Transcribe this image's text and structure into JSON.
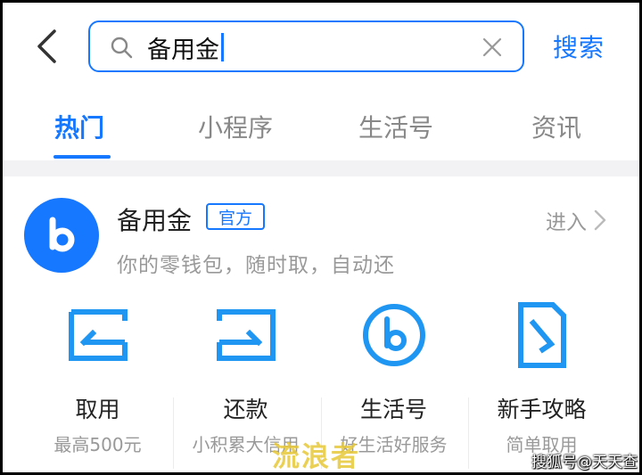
{
  "header": {
    "search_value": "备用金",
    "search_button": "搜索"
  },
  "tabs": [
    {
      "label": "热门",
      "active": true
    },
    {
      "label": "小程序",
      "active": false
    },
    {
      "label": "生活号",
      "active": false
    },
    {
      "label": "资讯",
      "active": false
    }
  ],
  "result": {
    "name": "备用金",
    "badge": "官方",
    "enter": "进入",
    "description": "你的零钱包，随时取，自动还",
    "services": [
      {
        "label": "取用",
        "subtitle": "最高500元",
        "icon": "withdraw-icon"
      },
      {
        "label": "还款",
        "subtitle": "小积累大信用",
        "icon": "repay-icon"
      },
      {
        "label": "生活号",
        "subtitle": "好生活好服务",
        "icon": "life-account-icon"
      },
      {
        "label": "新手攻略",
        "subtitle": "简单取用",
        "icon": "guide-icon"
      }
    ]
  },
  "watermarks": {
    "center": "流浪者",
    "corner": "搜狐号@天天查"
  },
  "colors": {
    "accent": "#1677ff",
    "muted_text": "#999999",
    "band": "#f2f2f4"
  }
}
